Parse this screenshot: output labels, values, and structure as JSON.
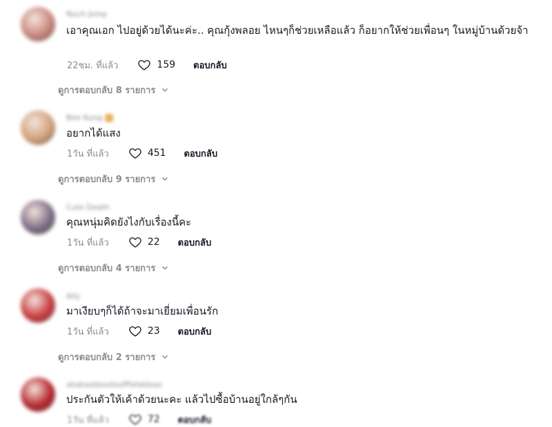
{
  "comments": [
    {
      "avatar_color": "#c9877d",
      "username": "Nuch Jomp",
      "text": "เอาคุณเอก ไปอยู่ด้วยได้นะค่ะ.. คุณกุ้งพลอย ไหนๆก็ช่วยเหลือแล้ว ก็อยากให้ช่วยเพื่อนๆ ในหมู่บ้านด้วยจ้า",
      "time": "22ชม. ที่แล้ว",
      "likes": "159",
      "reply_label": "ตอบกลับ",
      "view_replies": "ดูการตอบกลับ 8 รายการ"
    },
    {
      "avatar_color": "#d2a27a",
      "username": "Bee Kung",
      "text": "อยากได้แสง",
      "time": "1วัน ที่แล้ว",
      "likes": "451",
      "reply_label": "ตอบกลับ",
      "view_replies": "ดูการตอบกลับ 9 รายการ"
    },
    {
      "avatar_color": "#7c6d86",
      "username": "Cute Death",
      "text": "คุณหนุ่มคิดยังไงกับเรื่องนี้คะ",
      "time": "1วัน ที่แล้ว",
      "likes": "22",
      "reply_label": "ตอบกลับ",
      "view_replies": "ดูการตอบกลับ 4 รายการ"
    },
    {
      "avatar_color": "#c83a3e",
      "username": "Ally",
      "text": "มาเงียบๆก็ได้ถ้าจะมาเยี่ยมเพื่อนรัก",
      "time": "1วัน ที่แล้ว",
      "likes": "23",
      "reply_label": "ตอบกลับ",
      "view_replies": "ดูการตอบกลับ 2 รายการ"
    },
    {
      "avatar_color": "#b5262c",
      "username": "ababaddoodoofffafabbaa",
      "text": "ประกันตัวให้เค้าด้วยนะคะ แล้วไปซื้อบ้านอยู่ใกล้ๆกัน",
      "time": "1วัน ที่แล้ว",
      "likes": "72",
      "reply_label": "ตอบกลับ"
    }
  ]
}
